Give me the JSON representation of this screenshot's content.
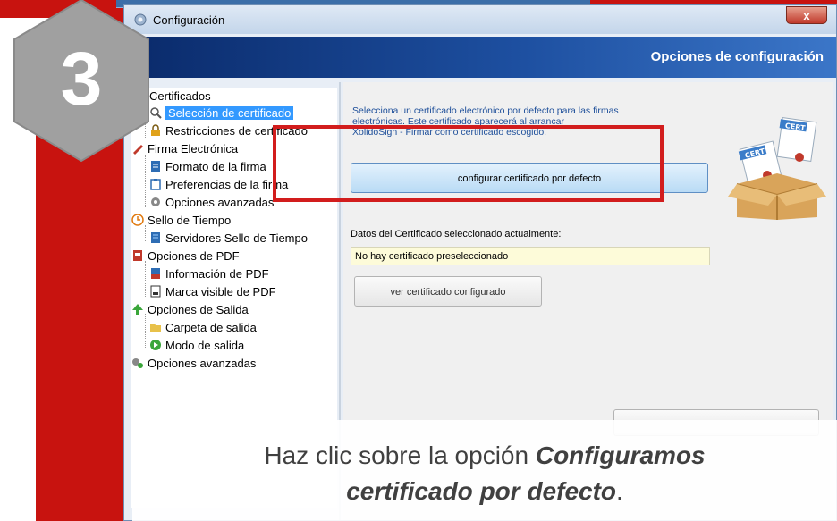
{
  "step": "3",
  "window": {
    "title": "Configuración",
    "close_label": "x",
    "banner_title": "Opciones de configuración"
  },
  "tree": {
    "items": [
      {
        "label": "Certificados"
      },
      {
        "label": "Selección de certificado"
      },
      {
        "label": "Restricciones de certificado"
      },
      {
        "label": "Firma Electrónica"
      },
      {
        "label": "Formato de la firma"
      },
      {
        "label": "Preferencias de la firma"
      },
      {
        "label": "Opciones avanzadas"
      },
      {
        "label": "Sello de Tiempo"
      },
      {
        "label": "Servidores Sello de Tiempo"
      },
      {
        "label": "Opciones de PDF"
      },
      {
        "label": "Información de PDF"
      },
      {
        "label": "Marca visible de PDF"
      },
      {
        "label": "Opciones de Salida"
      },
      {
        "label": "Carpeta de salida"
      },
      {
        "label": "Modo de salida"
      },
      {
        "label": "Opciones avanzadas"
      }
    ]
  },
  "content": {
    "info_line1": "Selecciona un certificado electrónico por defecto para las firmas",
    "info_line2": "electrónicas. Este certificado aparecerá al arrancar",
    "info_line3": "XolidoSign - Firmar como certificado escogido.",
    "configure_button": "configurar certificado por defecto",
    "current_label": "Datos del Certificado seleccionado actualmente:",
    "current_value": "No hay certificado preseleccionado",
    "view_button": "ver certificado configurado",
    "cert_badge_1": "CERT",
    "cert_badge_2": "CERT"
  },
  "caption": {
    "line1_prefix": "Haz clic sobre la opción ",
    "line1_emph": "Configuramos",
    "line2_emph": "certificado por defecto",
    "line2_suffix": "."
  },
  "colors": {
    "accent_red": "#c8130f",
    "banner_blue": "#0a2a6a",
    "selection_blue": "#3399ff"
  }
}
